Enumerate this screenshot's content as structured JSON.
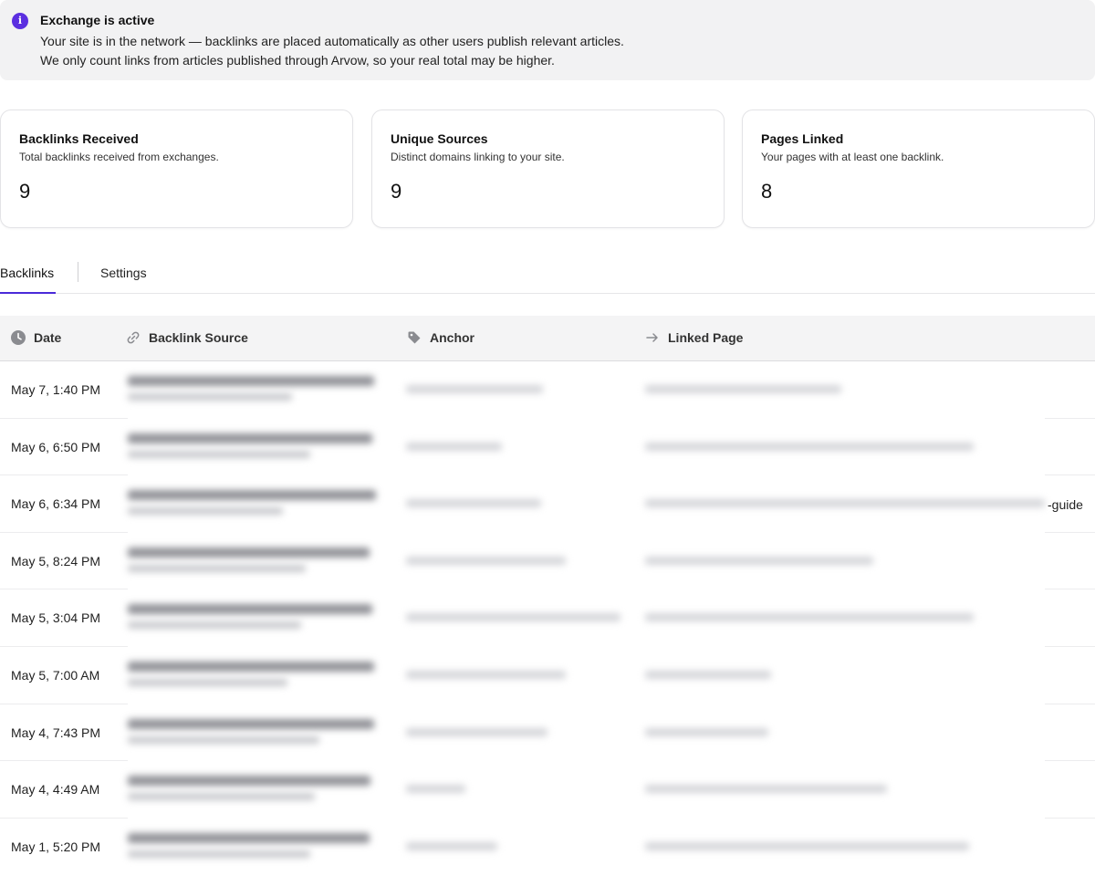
{
  "banner": {
    "title": "Exchange is active",
    "line1": "Your site is in the network — backlinks are placed automatically as other users publish relevant articles.",
    "line2": "We only count links from articles published through Arvow, so your real total may be higher.",
    "icon": "info-icon",
    "accent": "#5b2fe0"
  },
  "stats": [
    {
      "title": "Backlinks Received",
      "subtitle": "Total backlinks received from exchanges.",
      "value": "9"
    },
    {
      "title": "Unique Sources",
      "subtitle": "Distinct domains linking to your site.",
      "value": "9"
    },
    {
      "title": "Pages Linked",
      "subtitle": "Your pages with at least one backlink.",
      "value": "8"
    }
  ],
  "tabs": [
    {
      "label": "Backlinks",
      "active": true
    },
    {
      "label": "Settings",
      "active": false
    }
  ],
  "table": {
    "columns": [
      {
        "label": "Date",
        "icon": "clock-icon"
      },
      {
        "label": "Backlink Source",
        "icon": "link-icon"
      },
      {
        "label": "Anchor",
        "icon": "tag-icon"
      },
      {
        "label": "Linked Page",
        "icon": "arrow-right-icon"
      }
    ],
    "rows": [
      {
        "date": "May 7, 1:40 PM",
        "suffix": ""
      },
      {
        "date": "May 6, 6:50 PM",
        "suffix": ""
      },
      {
        "date": "May 6, 6:34 PM",
        "suffix": "-guide"
      },
      {
        "date": "May 5, 8:24 PM",
        "suffix": ""
      },
      {
        "date": "May 5, 3:04 PM",
        "suffix": ""
      },
      {
        "date": "May 5, 7:00 AM",
        "suffix": ""
      },
      {
        "date": "May 4, 7:43 PM",
        "suffix": ""
      },
      {
        "date": "May 4, 4:49 AM",
        "suffix": ""
      },
      {
        "date": "May 1, 5:20 PM",
        "suffix": ""
      }
    ]
  },
  "colors": {
    "tab_active_underline": "#4a2ad9",
    "header_bg": "#f4f4f5",
    "banner_bg": "#f2f2f3"
  }
}
